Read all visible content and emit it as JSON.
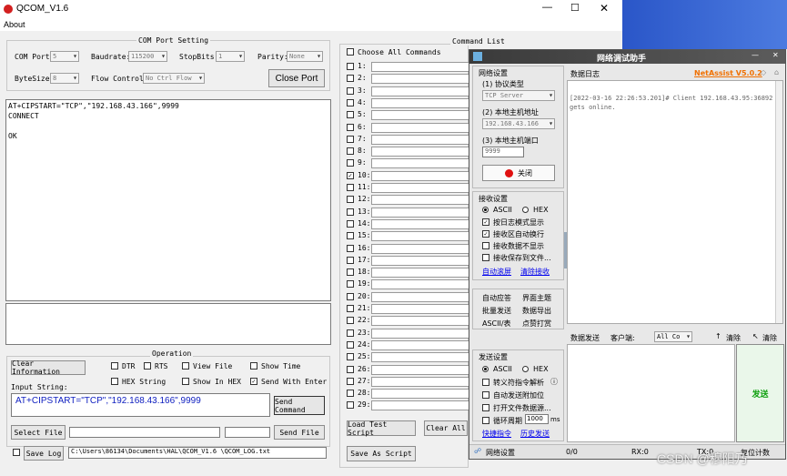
{
  "window": {
    "title": "QCOM_V1.6",
    "menu": [
      "About"
    ]
  },
  "com": {
    "legend": "COM Port Setting",
    "port_label": "COM Port:",
    "port_value": "5",
    "baud_label": "Baudrate:",
    "baud_value": "115200",
    "stop_label": "StopBits:",
    "stop_value": "1",
    "parity_label": "Parity:",
    "parity_value": "None",
    "bytesize_label": "ByteSize:",
    "bytesize_value": "8",
    "flow_label": "Flow Control:",
    "flow_value": "No Ctrl Flow",
    "close_button": "Close Port"
  },
  "receive": {
    "lines": [
      "AT+CIPSTART=\"TCP\",\"192.168.43.166\",9999",
      "CONNECT",
      "",
      "OK"
    ]
  },
  "operation": {
    "legend": "Operation",
    "clear_info": "Clear Information",
    "dtr": "DTR",
    "rts": "RTS",
    "view_file": "View File",
    "show_time": "Show Time",
    "hex_string": "HEX String",
    "show_in_hex": "Show In HEX",
    "send_with_enter": "Send With Enter",
    "input_label": "Input String:",
    "input_value": "AT+CIPSTART=\"TCP\",\"192.168.43.166\",9999",
    "send_command": "Send Command",
    "select_file": "Select File",
    "send_file": "Send File",
    "save_log": "Save Log",
    "log_path": "C:\\Users\\86134\\Documents\\HAL\\QCOM_V1.6 \\QCOM_LOG.txt"
  },
  "commands": {
    "legend": "Command List",
    "choose_all": "Choose All Commands",
    "rows": [
      "1:",
      "2:",
      "3:",
      "4:",
      "5:",
      "6:",
      "7:",
      "8:",
      "9:",
      "10:",
      "11:",
      "12:",
      "13:",
      "14:",
      "15:",
      "16:",
      "17:",
      "18:",
      "19:",
      "20:",
      "21:",
      "22:",
      "23:",
      "24:",
      "25:",
      "26:",
      "27:",
      "28:",
      "29:"
    ],
    "load_script": "Load Test Script",
    "clear_all": "Clear All",
    "save_script": "Save As Script"
  },
  "netassist": {
    "title": "网络调试助手",
    "brand": "NetAssist V5.0.2",
    "net_settings": "网络设置",
    "proto_label": "(1) 协议类型",
    "proto_value": "TCP Server",
    "host_label": "(2) 本地主机地址",
    "host_value": "192.168.43.166",
    "port_label": "(3) 本地主机端口",
    "port_value": "9999",
    "close_button": "关闭",
    "recv_settings": "接收设置",
    "ascii": "ASCII",
    "hex": "HEX",
    "recv_opts": [
      "按日志模式显示",
      "接收区自动换行",
      "接收数据不显示",
      "接收保存到文件..."
    ],
    "auto_scroll": "自动滚屏",
    "clear_recv": "清除接收",
    "mid_left": [
      "自动应答",
      "批量发送",
      "ASCII/表"
    ],
    "mid_right": [
      "界面主题",
      "数据导出",
      "点赞打赏"
    ],
    "send_settings": "发送设置",
    "send_opts": [
      "转义符指令解析",
      "自动发送附加位",
      "打开文件数据源...",
      "循环周期"
    ],
    "cycle_value": "1000",
    "cycle_unit": "ms",
    "quick_cmd": "快捷指令",
    "history": "历史发送",
    "data_log": "数据日志",
    "log_text": "[2022-03-16 22:26:53.201]# Client 192.168.43.95:36892 gets online.",
    "data_send": "数据发送",
    "client": "客户端:",
    "client_value": "All Co",
    "clear1": "清除",
    "clear2": "清除",
    "send_button": "发送",
    "status_net": "网络设置",
    "status_rx_count": "0/0",
    "status_rx": "RX:0",
    "status_tx": "TX:0",
    "status_reset": "复位计数"
  },
  "watermark": "CSDN @穆阳乃"
}
